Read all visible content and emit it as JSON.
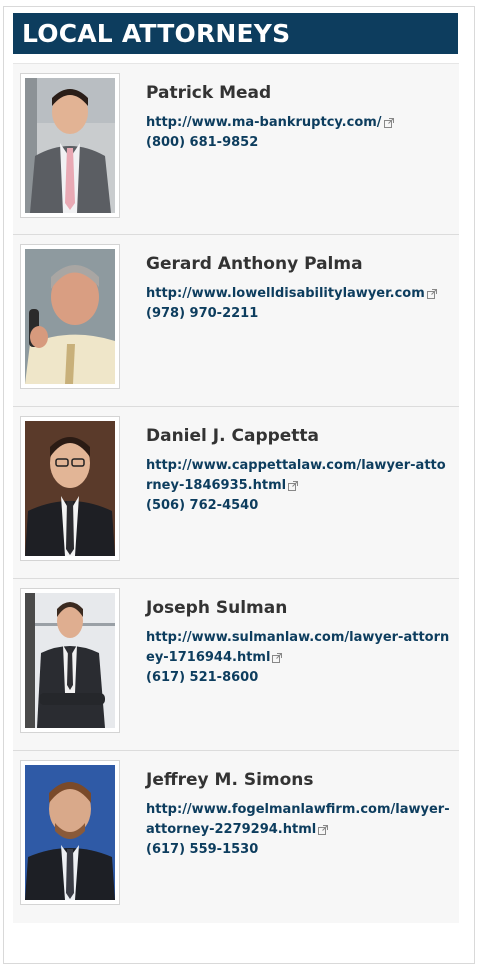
{
  "widget": {
    "title": "LOCAL ATTORNEYS"
  },
  "attorneys": [
    {
      "name": "Patrick Mead",
      "url": "http://www.ma-bankruptcy.com/",
      "phone": "(800) 681-9852"
    },
    {
      "name": "Gerard Anthony Palma",
      "url": "http://www.lowelldisabilitylawyer.com",
      "phone": "(978) 970-2211"
    },
    {
      "name": "Daniel J. Cappetta",
      "url": "http://www.cappettalaw.com/lawyer-attorney-1846935.html",
      "phone": "(506) 762-4540"
    },
    {
      "name": "Joseph Sulman",
      "url": "http://www.sulmanlaw.com/lawyer-attorney-1716944.html",
      "phone": "(617) 521-8600"
    },
    {
      "name": "Jeffrey M. Simons",
      "url": "http://www.fogelmanlawfirm.com/lawyer-attorney-2279294.html",
      "phone": "(617) 559-1530"
    }
  ],
  "colors": {
    "header_bg": "#0d3d5e",
    "link": "#0d3d5e",
    "card_bg": "#f7f7f7"
  },
  "icons": {
    "external": "external-link-icon"
  }
}
